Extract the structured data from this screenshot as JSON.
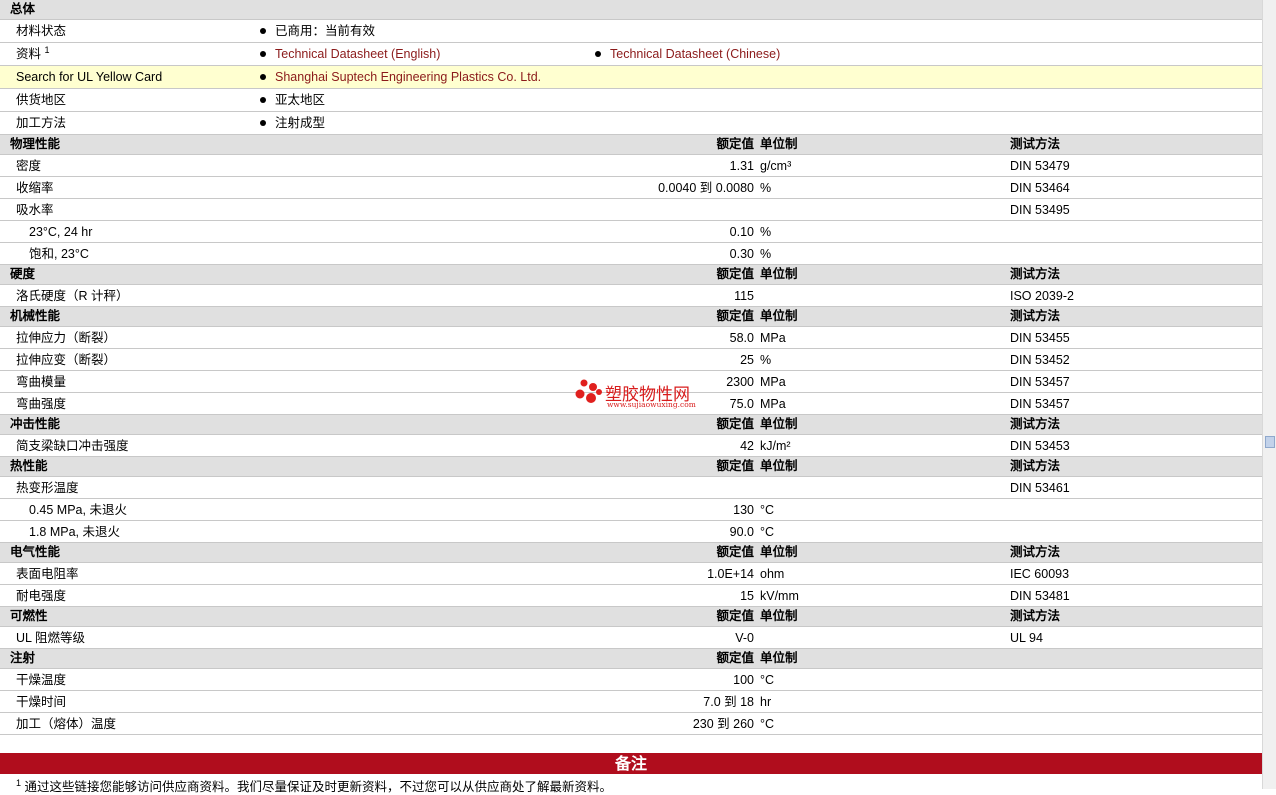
{
  "general": {
    "title": "总体",
    "rows": [
      {
        "label": "材料状态",
        "sup": "",
        "items": [
          "已商用：当前有效"
        ],
        "link": false,
        "highlight": false
      },
      {
        "label": "资料",
        "sup": "1",
        "items": [
          "Technical Datasheet (English)",
          "Technical Datasheet (Chinese)"
        ],
        "link": true,
        "highlight": false
      },
      {
        "label": "Search for UL Yellow Card",
        "sup": "",
        "items": [
          "Shanghai Suptech Engineering Plastics Co. Ltd."
        ],
        "link": true,
        "highlight": true
      },
      {
        "label": "供货地区",
        "sup": "",
        "items": [
          "亚太地区"
        ],
        "link": false,
        "highlight": false
      },
      {
        "label": "加工方法",
        "sup": "",
        "items": [
          "注射成型"
        ],
        "link": false,
        "highlight": false
      }
    ]
  },
  "header_labels": {
    "value": "额定值",
    "unit": "单位制",
    "method": "测试方法"
  },
  "sections": [
    {
      "title": "物理性能",
      "rows": [
        {
          "name": "密度",
          "value": "1.31",
          "unit": "g/cm³",
          "method": "DIN 53479",
          "sub": false
        },
        {
          "name": "收缩率",
          "value": "0.0040 到  0.0080",
          "unit": "%",
          "method": "DIN 53464",
          "sub": false
        },
        {
          "name": "吸水率",
          "value": "",
          "unit": "",
          "method": "DIN 53495",
          "sub": false
        },
        {
          "name": "23°C, 24 hr",
          "value": "0.10",
          "unit": "%",
          "method": "",
          "sub": true
        },
        {
          "name": "饱和, 23°C",
          "value": "0.30",
          "unit": "%",
          "method": "",
          "sub": true
        }
      ]
    },
    {
      "title": "硬度",
      "rows": [
        {
          "name": "洛氏硬度（R 计秤）",
          "value": "115",
          "unit": "",
          "method": "ISO 2039-2",
          "sub": false
        }
      ]
    },
    {
      "title": "机械性能",
      "rows": [
        {
          "name": "拉伸应力（断裂）",
          "value": "58.0",
          "unit": "MPa",
          "method": "DIN 53455",
          "sub": false
        },
        {
          "name": "拉伸应变（断裂）",
          "value": "25",
          "unit": "%",
          "method": "DIN 53452",
          "sub": false
        },
        {
          "name": "弯曲模量",
          "value": "2300",
          "unit": "MPa",
          "method": "DIN 53457",
          "sub": false
        },
        {
          "name": "弯曲强度",
          "value": "75.0",
          "unit": "MPa",
          "method": "DIN 53457",
          "sub": false
        }
      ]
    },
    {
      "title": "冲击性能",
      "rows": [
        {
          "name": "简支梁缺口冲击强度",
          "value": "42",
          "unit": "kJ/m²",
          "method": "DIN 53453",
          "sub": false
        }
      ]
    },
    {
      "title": "热性能",
      "rows": [
        {
          "name": "热变形温度",
          "value": "",
          "unit": "",
          "method": "DIN 53461",
          "sub": false
        },
        {
          "name": "0.45 MPa, 未退火",
          "value": "130",
          "unit": "°C",
          "method": "",
          "sub": true
        },
        {
          "name": "1.8 MPa, 未退火",
          "value": "90.0",
          "unit": "°C",
          "method": "",
          "sub": true
        }
      ]
    },
    {
      "title": "电气性能",
      "rows": [
        {
          "name": "表面电阻率",
          "value": "1.0E+14",
          "unit": "ohm",
          "method": "IEC 60093",
          "sub": false
        },
        {
          "name": "耐电强度",
          "value": "15",
          "unit": "kV/mm",
          "method": "DIN 53481",
          "sub": false
        }
      ]
    },
    {
      "title": "可燃性",
      "rows": [
        {
          "name": "UL 阻燃等级",
          "value": "V-0",
          "unit": "",
          "method": "UL 94",
          "sub": false
        }
      ]
    },
    {
      "title": "注射",
      "no_method": true,
      "rows": [
        {
          "name": "干燥温度",
          "value": "100",
          "unit": "°C",
          "method": "",
          "sub": false
        },
        {
          "name": "干燥时间",
          "value": "7.0 到  18",
          "unit": "hr",
          "method": "",
          "sub": false
        },
        {
          "name": "加工（熔体）温度",
          "value": "230 到  260",
          "unit": "°C",
          "method": "",
          "sub": false
        }
      ]
    }
  ],
  "notes": {
    "title": "备注",
    "note_number": "1",
    "note_text": "通过这些链接您能够访问供应商资料。我们尽量保证及时更新资料，不过您可以从供应商处了解最新资料。"
  },
  "watermark": {
    "text": "塑胶物性网",
    "subtext": "www.sujiaowuxing.com"
  },
  "colors": {
    "section_bg": "#e0e0e0",
    "highlight_bg": "#ffffd0",
    "link": "#8b1a1a",
    "notes_bar": "#b00d1d"
  }
}
